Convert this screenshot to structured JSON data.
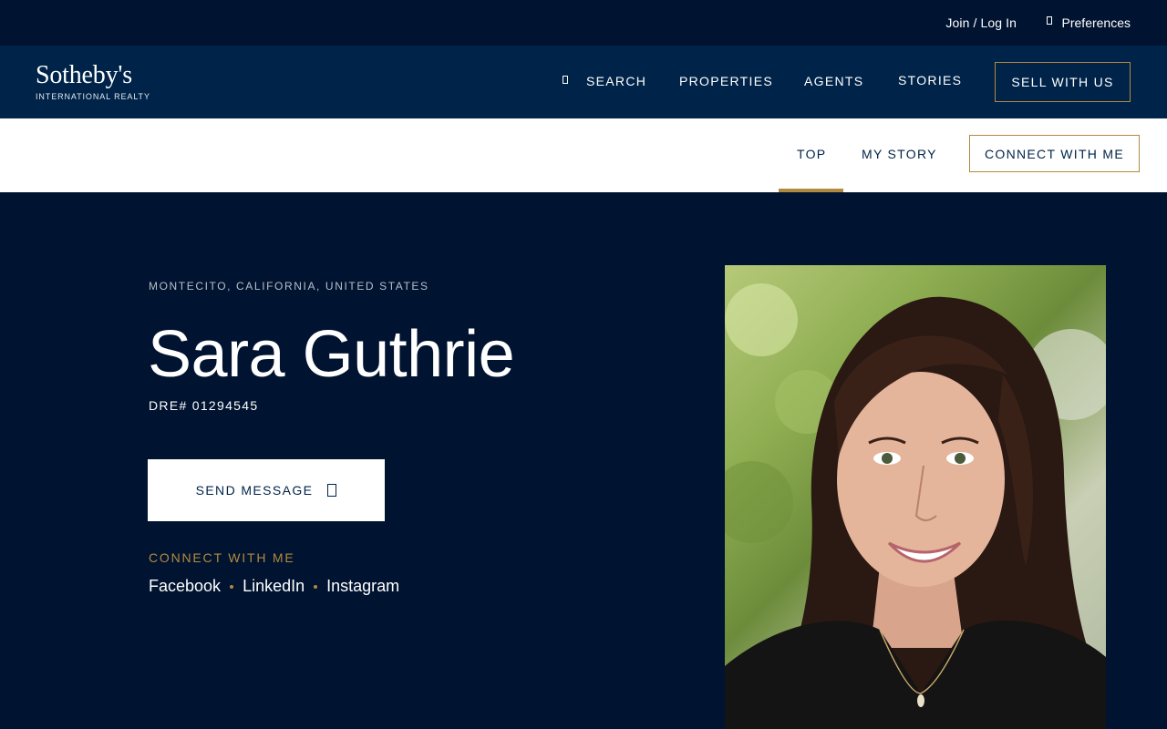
{
  "utility": {
    "join_label": "Join / Log In",
    "preferences_label": "Preferences"
  },
  "logo": {
    "wordmark": "Sotheby's",
    "subtitle": "INTERNATIONAL REALTY"
  },
  "nav": {
    "search": "SEARCH",
    "properties": "PROPERTIES",
    "agents": "AGENTS",
    "stories": "STORIES",
    "sell": "SELL WITH US"
  },
  "subnav": {
    "top": "TOP",
    "my_story": "MY STORY",
    "connect": "CONNECT WITH ME",
    "active_tab": "TOP"
  },
  "agent": {
    "location": "MONTECITO, CALIFORNIA, UNITED STATES",
    "name": "Sara Guthrie",
    "license": "DRE# 01294545",
    "send_message": "SEND MESSAGE",
    "connect_heading": "CONNECT WITH ME",
    "socials": [
      "Facebook",
      "LinkedIn",
      "Instagram"
    ]
  },
  "colors": {
    "navy_dark": "#001330",
    "navy": "#002349",
    "gold": "#b28a3f",
    "white": "#ffffff"
  }
}
